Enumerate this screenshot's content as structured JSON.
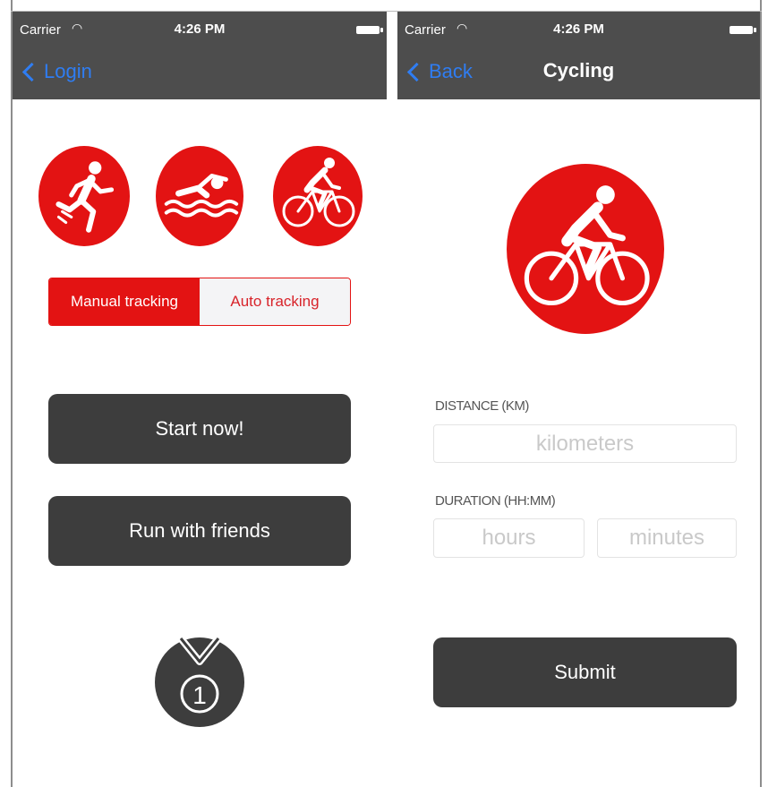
{
  "left_screen": {
    "status_bar": {
      "carrier": "Carrier",
      "time": "4:26 PM"
    },
    "nav": {
      "back_label": "Login"
    },
    "sports": [
      "running-icon",
      "swimming-icon",
      "cycling-icon"
    ],
    "tracking_toggle": {
      "selected": "Manual tracking",
      "options": [
        "Manual tracking",
        "Auto tracking"
      ]
    },
    "start_button": "Start now!",
    "friends_button": "Run with friends",
    "medal": {
      "icon": "medal-icon",
      "number": "1"
    }
  },
  "right_screen": {
    "status_bar": {
      "carrier": "Carrier",
      "time": "4:26 PM"
    },
    "nav": {
      "back_label": "Back",
      "title": "Cycling"
    },
    "sport_icon": "cycling-icon",
    "distance": {
      "label": "DISTANCE (KM)",
      "placeholder": "kilometers",
      "value": ""
    },
    "duration": {
      "label": "DURATION (HH:MM)",
      "hours_placeholder": "hours",
      "minutes_placeholder": "minutes"
    },
    "submit_button": "Submit"
  },
  "colors": {
    "accent_red": "#e31313",
    "nav_gray": "#4d4d4d",
    "button_dark": "#3d3d3d",
    "link_blue": "#2f7df2"
  }
}
